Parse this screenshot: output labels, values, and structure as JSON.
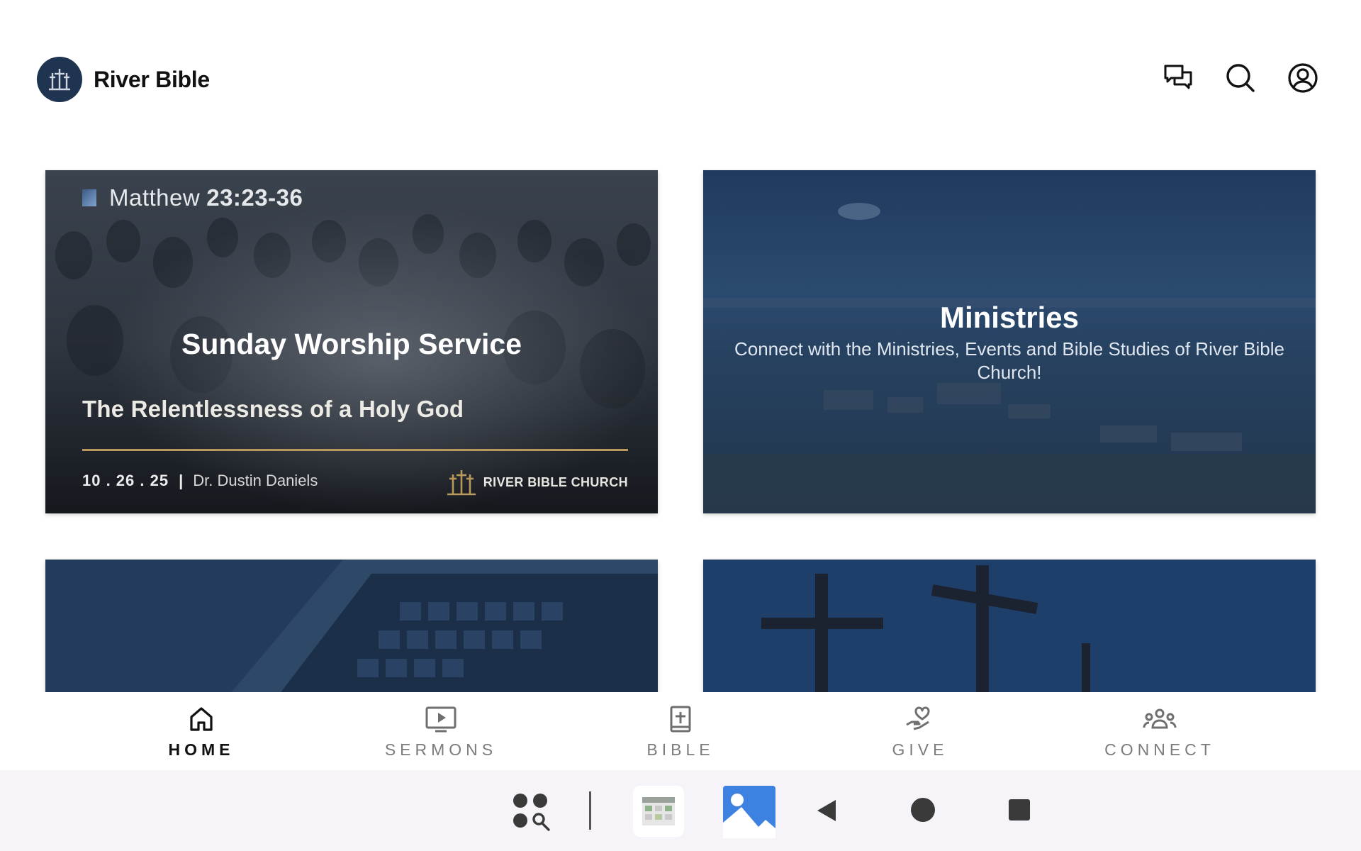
{
  "header": {
    "app_name": "River Bible"
  },
  "cards": {
    "sermon": {
      "scripture_book": "Matthew",
      "scripture_chapter": "23:23-36",
      "service_title": "Sunday Worship Service",
      "sermon_title": "The Relentlessness of a Holy God",
      "date": "10 . 26 . 25",
      "separator": "|",
      "speaker": "Dr. Dustin Daniels",
      "church_name": "RIVER BIBLE CHURCH"
    },
    "ministries": {
      "title": "Ministries",
      "description": "Connect with the Ministries, Events and Bible Studies of River Bible Church!"
    }
  },
  "bottom_nav": {
    "items": [
      {
        "label": "HOME",
        "icon": "home-icon",
        "active": true
      },
      {
        "label": "SERMONS",
        "icon": "sermons-play-icon",
        "active": false
      },
      {
        "label": "BIBLE",
        "icon": "bible-icon",
        "active": false
      },
      {
        "label": "GIVE",
        "icon": "give-hand-heart-icon",
        "active": false
      },
      {
        "label": "CONNECT",
        "icon": "connect-people-icon",
        "active": false
      }
    ]
  },
  "colors": {
    "brand_navy": "#1f3450",
    "gold_accent": "#b8995a",
    "card_overlay_blue": "#1e3a5f",
    "nav_active": "#111111",
    "nav_inactive": "#7c7c7c"
  }
}
